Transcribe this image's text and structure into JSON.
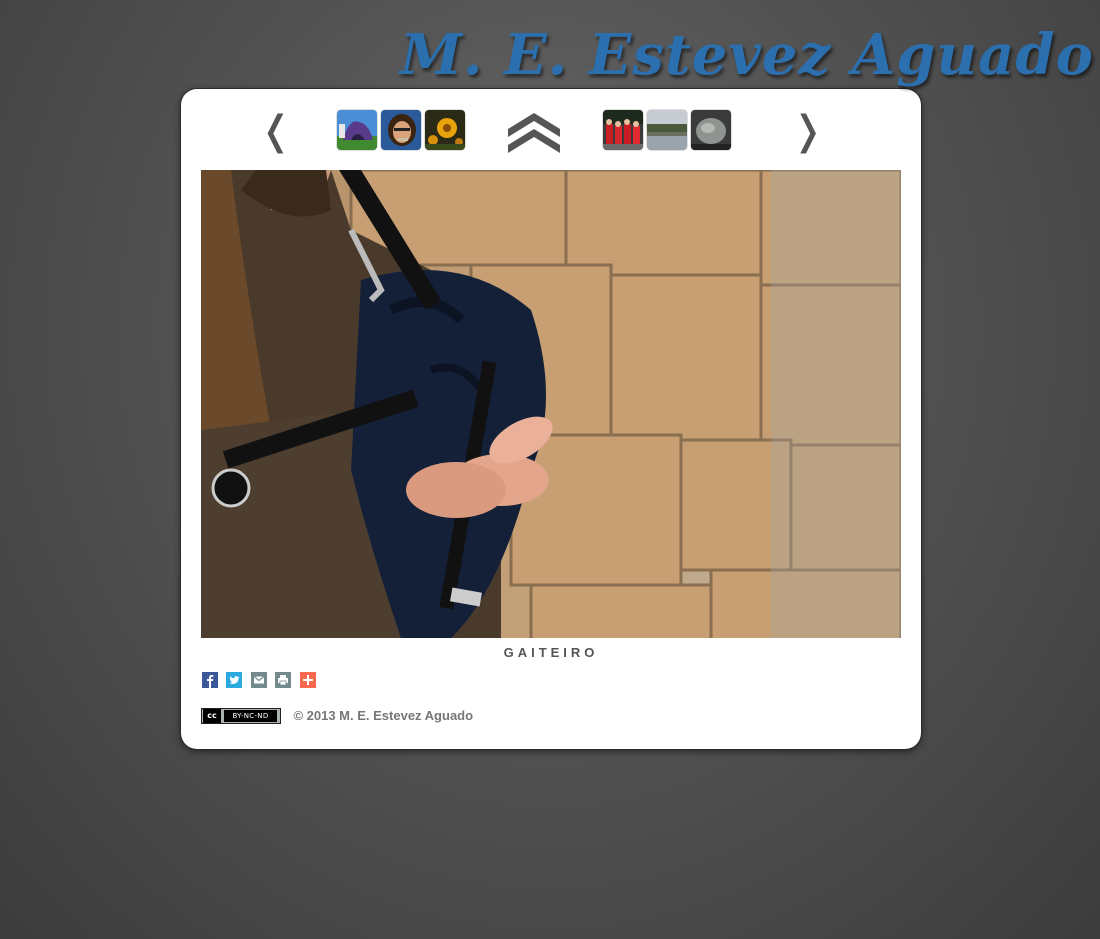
{
  "site": {
    "title": "M. E. Estevez Aguado"
  },
  "nav": {
    "prev_label": "❬",
    "next_label": "❭",
    "up_icon": "double-chevron-up-icon",
    "thumbnails_left": [
      {
        "name": "tent-thumbnail"
      },
      {
        "name": "portrait-thumbnail"
      },
      {
        "name": "flower-thumbnail"
      }
    ],
    "thumbnails_right": [
      {
        "name": "group-red-thumbnail"
      },
      {
        "name": "lake-thumbnail"
      },
      {
        "name": "stone-thumbnail"
      }
    ]
  },
  "photo": {
    "caption": "GAITEIRO"
  },
  "share": {
    "buttons": [
      {
        "name": "facebook-icon",
        "label": "f",
        "color": "#3b5998"
      },
      {
        "name": "twitter-icon",
        "label": "t",
        "color": "#2ba9e1"
      },
      {
        "name": "email-icon",
        "label": "✉",
        "color": "#738a8d"
      },
      {
        "name": "print-icon",
        "label": "⎙",
        "color": "#738a8d"
      },
      {
        "name": "more-share-icon",
        "label": "+",
        "color": "#f8694d"
      }
    ]
  },
  "footer": {
    "license_badge": "BY-NC-ND",
    "license_cc": "cc",
    "copyright": "© 2013 M. E. Estevez Aguado"
  },
  "colors": {
    "title": "#2b6fae",
    "background": "#4a4a4a",
    "panel": "#ffffff"
  }
}
